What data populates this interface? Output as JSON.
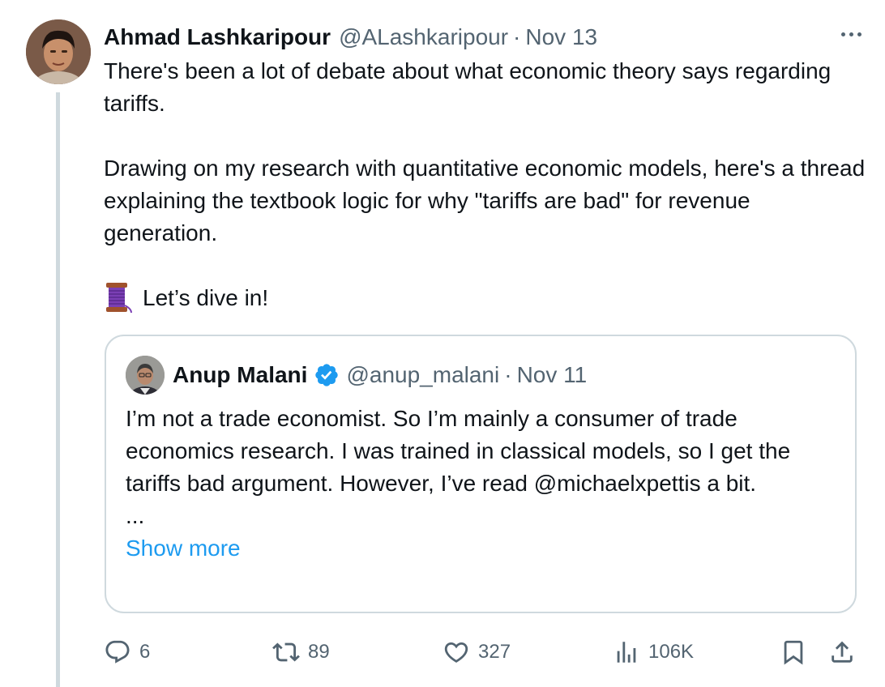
{
  "tweet": {
    "author_name": "Ahmad Lashkaripour",
    "author_handle": "@ALashkaripour",
    "separator": "·",
    "date": "Nov 13",
    "paragraphs": [
      "There's been a lot of debate about what economic theory says regarding tariffs.",
      "Drawing on my research with quantitative economic models, here's a thread explaining the textbook logic for why \"tariffs are bad\" for revenue generation."
    ],
    "emoji_icon": "spool-of-thread-icon",
    "closing_line": "Let’s dive in!"
  },
  "quote": {
    "author_name": "Anup Malani",
    "author_handle": "@anup_malani",
    "separator": "·",
    "date": "Nov 11",
    "text": "I’m not a trade economist. So I’m mainly a consumer of trade economics research.   I was trained in classical models, so I get the tariffs bad argument. However, I’ve read @michaelxpettis a bit.",
    "ellipsis": "...",
    "show_more": "Show more",
    "verified_color": "#1d9bf0"
  },
  "actions": {
    "replies": "6",
    "reposts": "89",
    "likes": "327",
    "views": "106K"
  },
  "colors": {
    "text_primary": "#0f1419",
    "text_secondary": "#536471",
    "link": "#1d9bf0",
    "border": "#cfd9de"
  }
}
